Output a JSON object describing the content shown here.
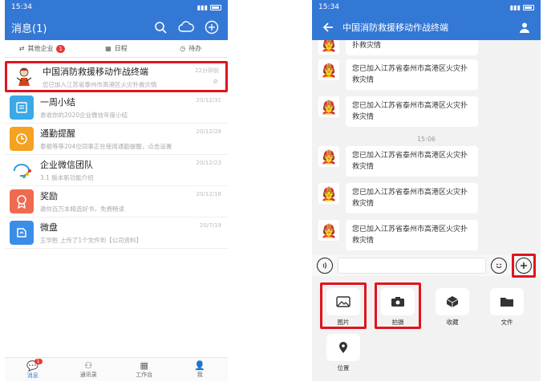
{
  "left": {
    "status": {
      "time": "15:34"
    },
    "appbar": {
      "title": "消息(1)"
    },
    "tabs": [
      {
        "label": "其他企业",
        "badge": "1"
      },
      {
        "label": "日程"
      },
      {
        "label": "待办"
      }
    ],
    "conversations": [
      {
        "name": "中国消防救援移动作战终端",
        "snippet": "您已加入江苏省泰州市高港区火灾扑救灾情",
        "time": "22分钟前",
        "avatar": "firefighter-icon"
      },
      {
        "name": "一周小结",
        "snippet": "袁收你的2020企业微信年度小结",
        "time": "20/12/31",
        "avatar": "weekly-icon"
      },
      {
        "name": "通勤提醒",
        "snippet": "泰振等等204位同事正在使用通勤提醒，点击设置",
        "time": "20/12/28",
        "avatar": "clock-icon"
      },
      {
        "name": "企业微信团队",
        "snippet": "3.1 版本新功能介绍",
        "time": "20/12/23",
        "avatar": "wecom-icon"
      },
      {
        "name": "奖励",
        "snippet": "邀你百万本精选好书，免费畅读",
        "time": "20/12/18",
        "avatar": "award-icon"
      },
      {
        "name": "微盘",
        "snippet": "王学胜 上传了1个文件到【公司资料】",
        "time": "20/7/19",
        "avatar": "drive-icon"
      }
    ],
    "bottomnav": [
      {
        "label": "消息",
        "badge": "1"
      },
      {
        "label": "通讯录"
      },
      {
        "label": "工作台"
      },
      {
        "label": "我"
      }
    ]
  },
  "right": {
    "status": {
      "time": "15:34"
    },
    "appbar": {
      "title": "中国消防救援移动作战终端"
    },
    "messages": [
      {
        "text": "扑救灾情"
      },
      {
        "text": "您已加入江苏省泰州市高港区火灾扑救灾情"
      },
      {
        "text": "您已加入江苏省泰州市高港区火灾扑救灾情"
      },
      {
        "text": "您已加入江苏省泰州市高港区火灾扑救灾情"
      },
      {
        "text": "您已加入江苏省泰州市高港区火灾扑救灾情"
      },
      {
        "text": "您已加入江苏省泰州市高港区火灾扑救灾情"
      }
    ],
    "timestamp": "15:06",
    "tools": [
      {
        "label": "图片"
      },
      {
        "label": "拍摄"
      },
      {
        "label": "收藏"
      },
      {
        "label": "文件"
      },
      {
        "label": "位置"
      }
    ]
  },
  "colors": {
    "brand": "#3478d6",
    "highlight": "#e0141e"
  }
}
